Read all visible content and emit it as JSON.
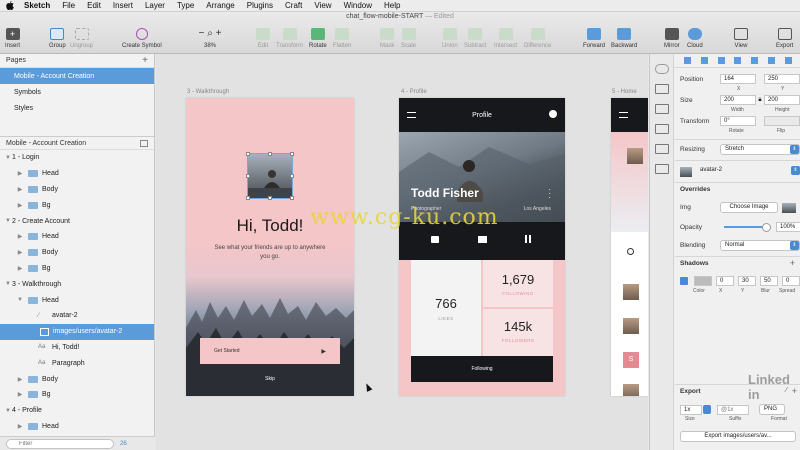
{
  "menubar": {
    "app": "Sketch",
    "items": [
      "File",
      "Edit",
      "Insert",
      "Layer",
      "Type",
      "Arrange",
      "Plugins",
      "Craft",
      "View",
      "Window",
      "Help"
    ]
  },
  "window": {
    "title": "chat_flow-mobile-START",
    "edited": "— Edited"
  },
  "toolbar": {
    "insert": "Insert",
    "group": "Group",
    "ungroup": "Ungroup",
    "create_symbol": "Create Symbol",
    "zoom": "38%",
    "edit": "Edit",
    "transform": "Transform",
    "rotate": "Rotate",
    "flatten": "Flatten",
    "mask": "Mask",
    "scale": "Scale",
    "union": "Union",
    "subtract": "Subtract",
    "intersect": "Intersect",
    "difference": "Difference",
    "forward": "Forward",
    "backward": "Backward",
    "mirror": "Mirror",
    "cloud": "Cloud",
    "view": "View",
    "export": "Export"
  },
  "sidebar": {
    "pages_title": "Pages",
    "pages": [
      "Mobile - Account Creation",
      "Symbols",
      "Styles"
    ],
    "current_page": "Mobile - Account Creation",
    "layers": [
      {
        "label": "1 - Login",
        "level": 0,
        "kind": "artboard",
        "open": true
      },
      {
        "label": "Head",
        "level": 1,
        "kind": "folder"
      },
      {
        "label": "Body",
        "level": 1,
        "kind": "folder"
      },
      {
        "label": "Bg",
        "level": 1,
        "kind": "folder"
      },
      {
        "label": "2 - Create Account",
        "level": 0,
        "kind": "artboard",
        "open": true
      },
      {
        "label": "Head",
        "level": 1,
        "kind": "folder"
      },
      {
        "label": "Body",
        "level": 1,
        "kind": "folder"
      },
      {
        "label": "Bg",
        "level": 1,
        "kind": "folder"
      },
      {
        "label": "3 - Walkthrough",
        "level": 0,
        "kind": "artboard",
        "open": true
      },
      {
        "label": "Head",
        "level": 1,
        "kind": "folder",
        "open": true
      },
      {
        "label": "avatar-2",
        "level": 2,
        "kind": "shape"
      },
      {
        "label": "images/users/avatar-2",
        "level": 2,
        "kind": "image",
        "selected": true
      },
      {
        "label": "Hi, Todd!",
        "level": 2,
        "kind": "text"
      },
      {
        "label": "Paragraph",
        "level": 2,
        "kind": "text"
      },
      {
        "label": "Body",
        "level": 1,
        "kind": "folder"
      },
      {
        "label": "Bg",
        "level": 1,
        "kind": "folder"
      },
      {
        "label": "4 - Profile",
        "level": 0,
        "kind": "artboard",
        "open": true
      },
      {
        "label": "Head",
        "level": 1,
        "kind": "folder"
      }
    ],
    "filter_placeholder": "Filter",
    "count": "26"
  },
  "canvas": {
    "walkthrough": {
      "label": "3 - Walkthrough",
      "greeting": "Hi, Todd!",
      "paragraph": "See what your friends are up to anywhere you go.",
      "cta": "Get Started",
      "skip": "Skip"
    },
    "profile": {
      "label": "4 - Profile",
      "nav_title": "Profile",
      "name": "Todd Fisher",
      "job": "Photographer",
      "location": "Los Angeles",
      "likes": "766",
      "likes_label": "LIKES",
      "following": "1,679",
      "following_label": "FOLLOWING",
      "followers": "145k",
      "followers_label": "FOLLOWERS",
      "button": "Following"
    },
    "home": {
      "label": "5 - Home",
      "badge": "S"
    },
    "watermark": "www.cg-ku.com"
  },
  "inspector": {
    "position_label": "Position",
    "x": "164",
    "y": "250",
    "x_label": "X",
    "y_label": "Y",
    "size_label": "Size",
    "width": "200",
    "height": "200",
    "width_label": "Width",
    "height_label": "Height",
    "transform_label": "Transform",
    "rotate": "0°",
    "rotate_label": "Rotate",
    "flip_label": "Flip",
    "resizing_label": "Resizing",
    "resizing": "Stretch",
    "symbol": "avatar-2",
    "overrides_label": "Overrides",
    "img_label": "Img",
    "choose_image": "Choose Image",
    "opacity_label": "Opacity",
    "opacity": "100%",
    "blending_label": "Blending",
    "blending": "Normal",
    "shadows_label": "Shadows",
    "shadow_x": "0",
    "shadow_y": "30",
    "shadow_blur": "50",
    "shadow_spread": "0",
    "shadow_sub": [
      "Color",
      "X",
      "Y",
      "Blur",
      "Spread"
    ],
    "export_label": "Export",
    "export_size": "1x",
    "export_suffix": "@1x",
    "export_format": "PNG",
    "export_sub": [
      "Size",
      "Suffix",
      "Format"
    ],
    "export_button": "Export images/users/av..."
  },
  "colors": {
    "accent": "#5b9bd9",
    "pink": "#f5c6c8",
    "dark": "#17181b"
  },
  "watermark_brand": "Linked in"
}
